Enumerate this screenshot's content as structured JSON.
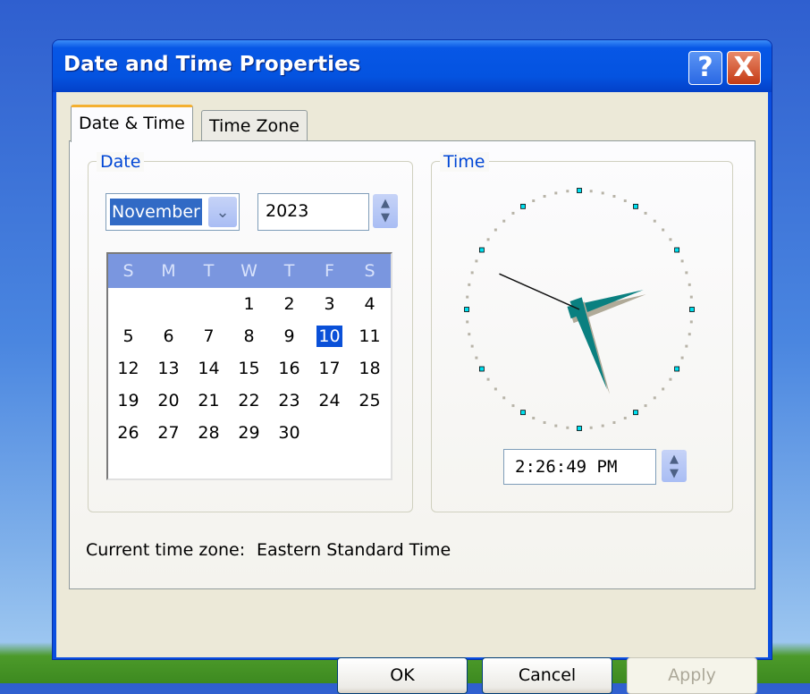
{
  "window": {
    "title": "Date and Time Properties",
    "help_label": "?",
    "close_label": "X"
  },
  "tabs": [
    {
      "label": "Date & Time",
      "active": true
    },
    {
      "label": "Time Zone",
      "active": false
    }
  ],
  "date": {
    "group_label": "Date",
    "month": "November",
    "year": "2023",
    "weekdays": [
      "S",
      "M",
      "T",
      "W",
      "T",
      "F",
      "S"
    ],
    "days": [
      "",
      "",
      "",
      "1",
      "2",
      "3",
      "4",
      "5",
      "6",
      "7",
      "8",
      "9",
      "10",
      "11",
      "12",
      "13",
      "14",
      "15",
      "16",
      "17",
      "18",
      "19",
      "20",
      "21",
      "22",
      "23",
      "24",
      "25",
      "26",
      "27",
      "28",
      "29",
      "30"
    ],
    "selected_day": "10"
  },
  "time": {
    "group_label": "Time",
    "value": "2:26:49 PM",
    "hour": 14,
    "minute": 26,
    "second": 49,
    "hand_color": "#0a8080"
  },
  "timezone": {
    "label": "Current time zone:",
    "value": "Eastern Standard Time"
  },
  "buttons": {
    "ok": "OK",
    "cancel": "Cancel",
    "apply": "Apply"
  },
  "colors": {
    "title_bar": "#0453e0",
    "selection": "#0a50d8",
    "calendar_header": "#7a96df",
    "group_label": "#0046d5"
  }
}
